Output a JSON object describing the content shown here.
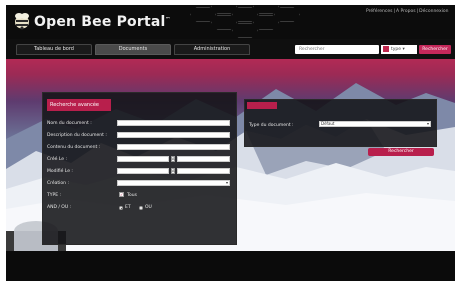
{
  "header": {
    "app_title": "Open Bee Portal",
    "trademark": "™",
    "top_links": [
      "Préférences",
      "|",
      "A Propos",
      "|",
      "Déconnexion"
    ]
  },
  "nav": {
    "tabs": [
      {
        "label": "Tableau de bord",
        "active": false
      },
      {
        "label": "Documents",
        "active": true
      },
      {
        "label": "Administration",
        "active": false
      }
    ],
    "search_placeholder": "Rechercher",
    "type_label": "type ▾",
    "search_button": "Rechercher"
  },
  "advanced": {
    "title": "Recherche avancée",
    "fields": [
      "Nom du document :",
      "Description du document :",
      "Contenu du document :",
      "Créé Le :",
      "Modifié Le :",
      "Création :"
    ],
    "type_label": "TYPE :",
    "all_label": "Tous",
    "and_or_label": "AND / OU :",
    "et_label": "ET",
    "ou_label": "OU",
    "date_sep": "A"
  },
  "doctype": {
    "label": "Type du document :",
    "selected": "Défaut"
  },
  "find_button": "Rechercher",
  "colors": {
    "accent": "#b81f4c",
    "header_bg": "#0c0c0c"
  }
}
